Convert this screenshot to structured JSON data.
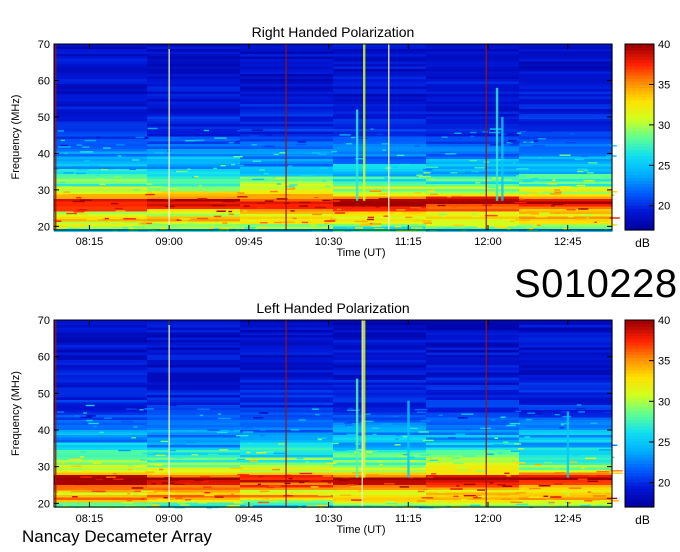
{
  "identifier": "S010228",
  "footer_text": "Nancay Decameter Array",
  "colorbar_unit": "dB",
  "colorscale": [
    "#0000a0",
    "#0018d8",
    "#0060ff",
    "#00b0ff",
    "#10e0f0",
    "#60ff90",
    "#d0ff20",
    "#ffe000",
    "#ff8c00",
    "#ff2000",
    "#a00000"
  ],
  "chart_data": [
    {
      "type": "heatmap",
      "title": "Right Handed Polarization",
      "xlabel": "Time (UT)",
      "ylabel": "Frequency (MHz)",
      "x_ticks": [
        "08:15",
        "09:00",
        "09:45",
        "10:30",
        "11:15",
        "12:00",
        "12:45"
      ],
      "x_tick_minutes": [
        495,
        540,
        585,
        630,
        675,
        720,
        765
      ],
      "xlim_minutes": [
        475,
        790
      ],
      "y_ticks": [
        20,
        30,
        40,
        50,
        60,
        70
      ],
      "ylim": [
        19,
        70
      ],
      "colorbar": {
        "label": "dB",
        "ticks": [
          20,
          25,
          30,
          35,
          40
        ],
        "range": [
          17,
          40
        ]
      },
      "band_profile_db": [
        {
          "freq_mhz": 19,
          "db": 26
        },
        {
          "freq_mhz": 20.5,
          "db": 30
        },
        {
          "freq_mhz": 22,
          "db": 34
        },
        {
          "freq_mhz": 23.5,
          "db": 31
        },
        {
          "freq_mhz": 25,
          "db": 38
        },
        {
          "freq_mhz": 26.5,
          "db": 40
        },
        {
          "freq_mhz": 27.5,
          "db": 38
        },
        {
          "freq_mhz": 29,
          "db": 32
        },
        {
          "freq_mhz": 31,
          "db": 29
        },
        {
          "freq_mhz": 33,
          "db": 27
        },
        {
          "freq_mhz": 36,
          "db": 24
        },
        {
          "freq_mhz": 40,
          "db": 23
        },
        {
          "freq_mhz": 45,
          "db": 20
        },
        {
          "freq_mhz": 55,
          "db": 19
        },
        {
          "freq_mhz": 70,
          "db": 18.5
        }
      ],
      "vertical_markers": [
        {
          "time_minutes": 476,
          "color": "#a01010"
        },
        {
          "time_minutes": 540,
          "color": "#ffffd0"
        },
        {
          "time_minutes": 606,
          "color": "#a01010"
        },
        {
          "time_minutes": 664,
          "color": "#ffffd0"
        },
        {
          "time_minutes": 719,
          "color": "#a01010"
        }
      ],
      "bursts": [
        {
          "time_minutes": 650,
          "db": 31,
          "top_mhz": 70
        },
        {
          "time_minutes": 646,
          "db": 27,
          "top_mhz": 52
        },
        {
          "time_minutes": 725,
          "db": 27,
          "top_mhz": 58
        },
        {
          "time_minutes": 728,
          "db": 25,
          "top_mhz": 50
        }
      ]
    },
    {
      "type": "heatmap",
      "title": "Left Handed Polarization",
      "xlabel": "Time (UT)",
      "ylabel": "Frequency (MHz)",
      "x_ticks": [
        "08:15",
        "09:00",
        "09:45",
        "10:30",
        "11:15",
        "12:00",
        "12:45"
      ],
      "x_tick_minutes": [
        495,
        540,
        585,
        630,
        675,
        720,
        765
      ],
      "xlim_minutes": [
        475,
        790
      ],
      "y_ticks": [
        20,
        30,
        40,
        50,
        60,
        70
      ],
      "ylim": [
        19,
        70
      ],
      "colorbar": {
        "label": "dB",
        "ticks": [
          20,
          25,
          30,
          35,
          40
        ],
        "range": [
          17,
          40
        ]
      },
      "band_profile_db": [
        {
          "freq_mhz": 19,
          "db": 26
        },
        {
          "freq_mhz": 20.5,
          "db": 31
        },
        {
          "freq_mhz": 21.5,
          "db": 35
        },
        {
          "freq_mhz": 23,
          "db": 32
        },
        {
          "freq_mhz": 25,
          "db": 37
        },
        {
          "freq_mhz": 26.5,
          "db": 40
        },
        {
          "freq_mhz": 27.5,
          "db": 37
        },
        {
          "freq_mhz": 29,
          "db": 31
        },
        {
          "freq_mhz": 31,
          "db": 29
        },
        {
          "freq_mhz": 33,
          "db": 27
        },
        {
          "freq_mhz": 36,
          "db": 24
        },
        {
          "freq_mhz": 40,
          "db": 23
        },
        {
          "freq_mhz": 45,
          "db": 20
        },
        {
          "freq_mhz": 55,
          "db": 19
        },
        {
          "freq_mhz": 70,
          "db": 18.5
        }
      ],
      "vertical_markers": [
        {
          "time_minutes": 476,
          "color": "#a01010"
        },
        {
          "time_minutes": 540,
          "color": "#ffffd0"
        },
        {
          "time_minutes": 606,
          "color": "#a01010"
        },
        {
          "time_minutes": 649,
          "color": "#ffffd0"
        },
        {
          "time_minutes": 719,
          "color": "#a01010"
        }
      ],
      "bursts": [
        {
          "time_minutes": 650,
          "db": 31,
          "top_mhz": 70
        },
        {
          "time_minutes": 646,
          "db": 28,
          "top_mhz": 54
        },
        {
          "time_minutes": 675,
          "db": 25,
          "top_mhz": 48
        },
        {
          "time_minutes": 765,
          "db": 25,
          "top_mhz": 45
        }
      ]
    }
  ]
}
